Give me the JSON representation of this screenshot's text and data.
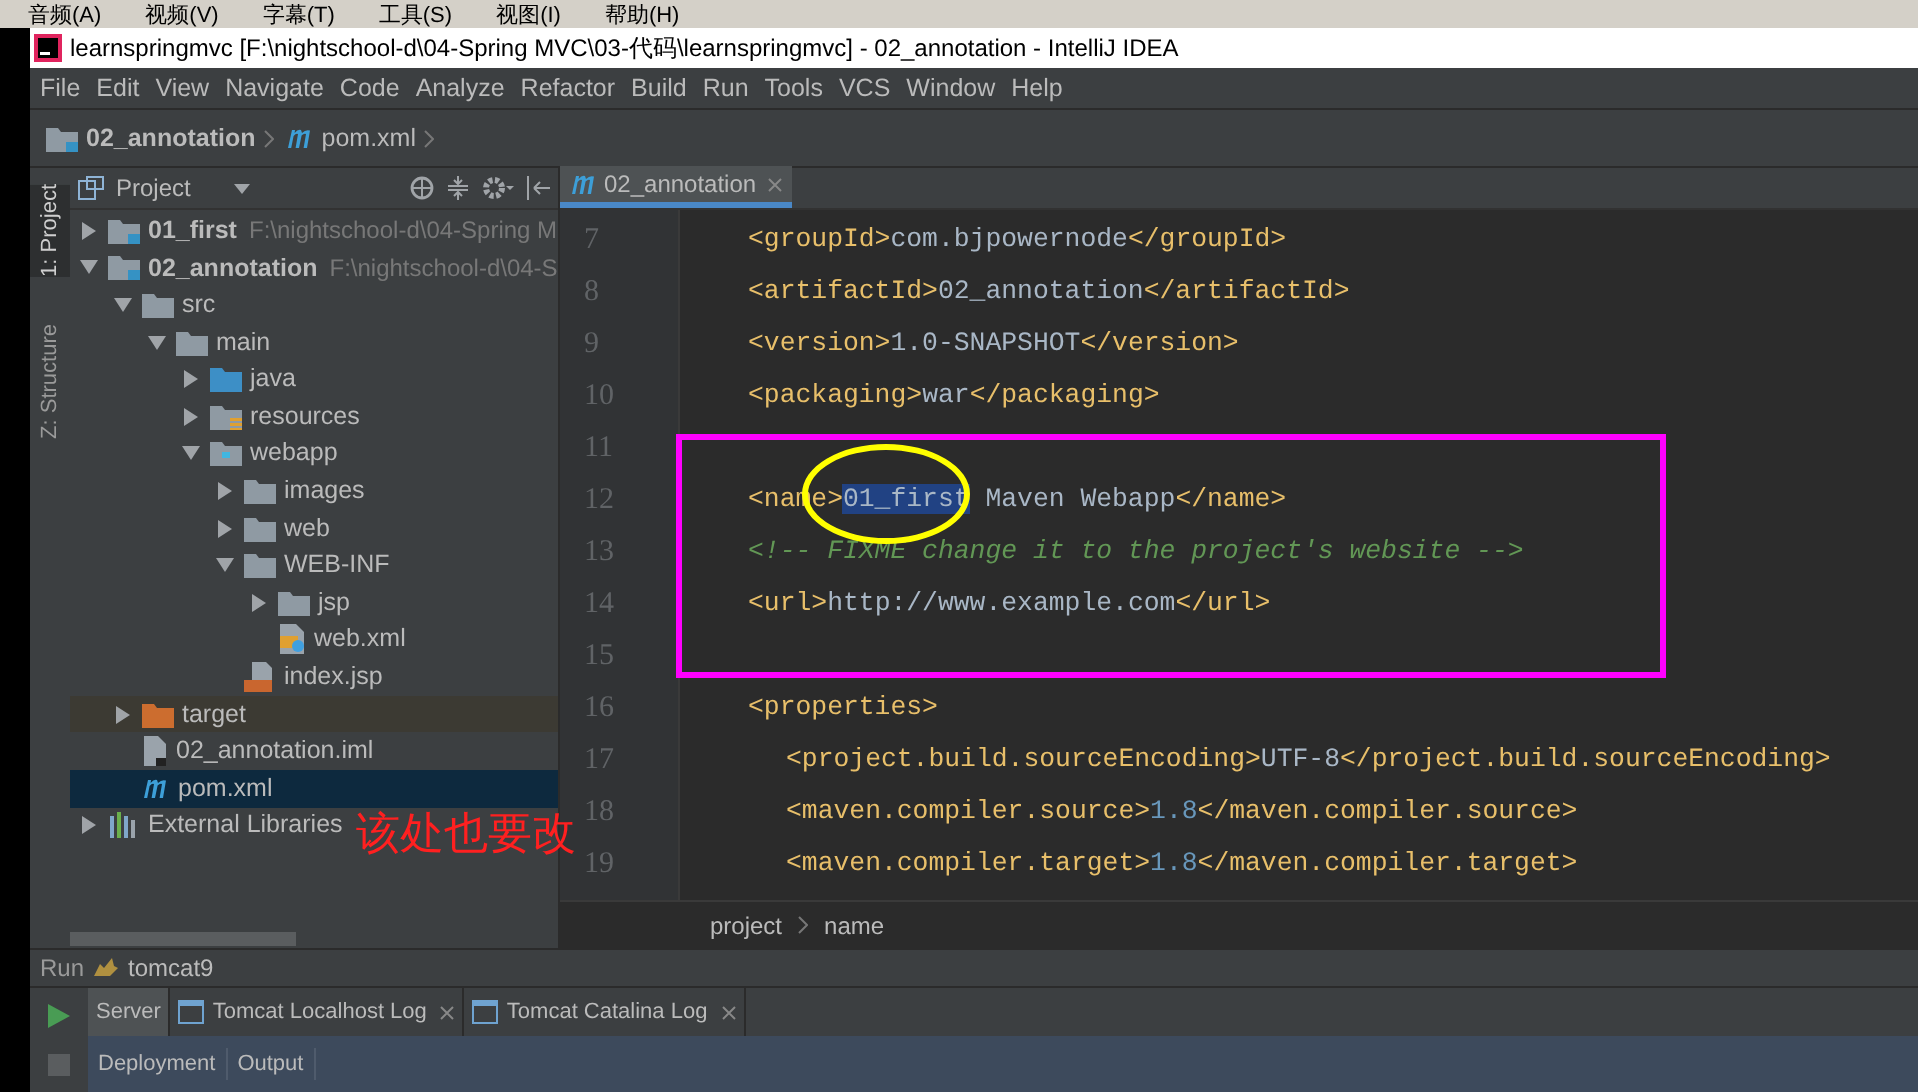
{
  "host_menu": [
    "音频(A)",
    "视频(V)",
    "字幕(T)",
    "工具(S)",
    "视图(I)",
    "帮助(H)"
  ],
  "window": {
    "title": "learnspringmvc [F:\\nightschool-d\\04-Spring MVC\\03-代码\\learnspringmvc] - 02_annotation - IntelliJ IDEA"
  },
  "menu": [
    "File",
    "Edit",
    "View",
    "Navigate",
    "Code",
    "Analyze",
    "Refactor",
    "Build",
    "Run",
    "Tools",
    "VCS",
    "Window",
    "Help"
  ],
  "nav_bar": [
    {
      "kind": "module",
      "label": "02_annotation"
    },
    {
      "kind": "maven",
      "label": "pom.xml"
    }
  ],
  "tool_stripe": [
    {
      "label": "1: Project",
      "selected": true
    },
    {
      "label": "Z: Structure",
      "selected": false
    }
  ],
  "project_panel": {
    "title": "Project",
    "tree": [
      {
        "kind": "module",
        "label": "01_first",
        "path": "F:\\nightschool-d\\04-Spring M",
        "expanded": false,
        "selected": false
      },
      {
        "kind": "module",
        "label": "02_annotation",
        "path": "F:\\nightschool-d\\04-S",
        "expanded": true,
        "selected": false,
        "children": [
          {
            "kind": "folder",
            "label": "src",
            "expanded": true,
            "selected": false,
            "children": [
              {
                "kind": "folder",
                "label": "main",
                "expanded": true,
                "selected": false,
                "children": [
                  {
                    "kind": "source",
                    "label": "java",
                    "expanded": false,
                    "selected": false
                  },
                  {
                    "kind": "resources",
                    "label": "resources",
                    "expanded": false,
                    "selected": false
                  },
                  {
                    "kind": "web",
                    "label": "webapp",
                    "expanded": true,
                    "selected": false,
                    "children": [
                      {
                        "kind": "folder",
                        "label": "images",
                        "expanded": false,
                        "selected": false
                      },
                      {
                        "kind": "folder",
                        "label": "web",
                        "expanded": false,
                        "selected": false
                      },
                      {
                        "kind": "folder",
                        "label": "WEB-INF",
                        "expanded": true,
                        "selected": false,
                        "children": [
                          {
                            "kind": "folder",
                            "label": "jsp",
                            "expanded": false,
                            "selected": false
                          },
                          {
                            "kind": "xml",
                            "label": "web.xml",
                            "selected": false
                          }
                        ]
                      },
                      {
                        "kind": "jsp",
                        "label": "index.jsp",
                        "selected": false
                      }
                    ]
                  }
                ]
              }
            ]
          },
          {
            "kind": "excluded",
            "label": "target",
            "expanded": false,
            "selected": false
          },
          {
            "kind": "iml",
            "label": "02_annotation.iml",
            "selected": false
          },
          {
            "kind": "maven",
            "label": "pom.xml",
            "selected": true
          }
        ]
      },
      {
        "kind": "libraries",
        "label": "External Libraries",
        "expanded": false,
        "selected": false
      }
    ]
  },
  "editor": {
    "tabs": [
      {
        "label": "02_annotation",
        "selected": true
      }
    ],
    "lines": [
      {
        "number": "7",
        "kind": "top",
        "parts": [
          {
            "kind": "tag",
            "text": "<groupId>"
          },
          {
            "kind": "text",
            "text": "com.bjpowernode"
          },
          {
            "kind": "tag",
            "text": "</groupId>"
          }
        ]
      },
      {
        "number": "8",
        "kind": "top",
        "parts": [
          {
            "kind": "tag",
            "text": "<artifactId>"
          },
          {
            "kind": "text",
            "text": "02_annotation"
          },
          {
            "kind": "tag",
            "text": "</artifactId>"
          }
        ]
      },
      {
        "number": "9",
        "kind": "top",
        "parts": [
          {
            "kind": "tag",
            "text": "<version>"
          },
          {
            "kind": "text",
            "text": "1.0-SNAPSHOT"
          },
          {
            "kind": "tag",
            "text": "</version>"
          }
        ]
      },
      {
        "number": "10",
        "kind": "top",
        "parts": [
          {
            "kind": "tag",
            "text": "<packaging>"
          },
          {
            "kind": "text",
            "text": "war"
          },
          {
            "kind": "tag",
            "text": "</packaging>"
          }
        ]
      },
      {
        "number": "11",
        "kind": "top"
      },
      {
        "number": "12",
        "kind": "top",
        "parts": [
          {
            "kind": "tag",
            "text": "<name>"
          },
          {
            "kind": "selected",
            "text": "01_first"
          },
          {
            "kind": "text",
            "text": " Maven Webapp"
          },
          {
            "kind": "tag",
            "text": "</name>"
          }
        ]
      },
      {
        "number": "13",
        "kind": "top",
        "parts": [
          {
            "kind": "comment",
            "text": "<!-- FIXME change it to the project's website -->"
          }
        ]
      },
      {
        "number": "14",
        "kind": "top",
        "parts": [
          {
            "kind": "tag",
            "text": "<url>"
          },
          {
            "kind": "text",
            "text": "http://www.example.com"
          },
          {
            "kind": "tag",
            "text": "</url>"
          }
        ]
      },
      {
        "number": "15",
        "kind": "top"
      },
      {
        "number": "16",
        "kind": "top",
        "parts": [
          {
            "kind": "tag",
            "text": "<properties>"
          }
        ]
      },
      {
        "number": "17",
        "kind": "nested",
        "parts": [
          {
            "kind": "tag",
            "text": "<project.build.sourceEncoding>"
          },
          {
            "kind": "text",
            "text": "UTF-8"
          },
          {
            "kind": "tag",
            "text": "</project.build.sourceEncoding>"
          }
        ]
      },
      {
        "number": "18",
        "kind": "nested",
        "parts": [
          {
            "kind": "tag",
            "text": "<maven.compiler.source>"
          },
          {
            "kind": "number",
            "text": "1.8"
          },
          {
            "kind": "tag",
            "text": "</maven.compiler.source>"
          }
        ]
      },
      {
        "number": "19",
        "kind": "nested",
        "parts": [
          {
            "kind": "tag",
            "text": "<maven.compiler.target>"
          },
          {
            "kind": "number",
            "text": "1.8"
          },
          {
            "kind": "tag",
            "text": "</maven.compiler.target>"
          }
        ]
      }
    ],
    "breadcrumbs": [
      "project",
      "name"
    ]
  },
  "annotation": {
    "note": "该处也要改"
  },
  "run_panel": {
    "label": "Run",
    "config": "tomcat9",
    "tabs": [
      {
        "label": "Server",
        "closable": false,
        "selected": true
      },
      {
        "label": "Tomcat Localhost Log",
        "closable": true,
        "selected": false
      },
      {
        "label": "Tomcat Catalina Log",
        "closable": true,
        "selected": false
      }
    ],
    "subtabs": [
      "Deployment",
      "Output"
    ]
  }
}
